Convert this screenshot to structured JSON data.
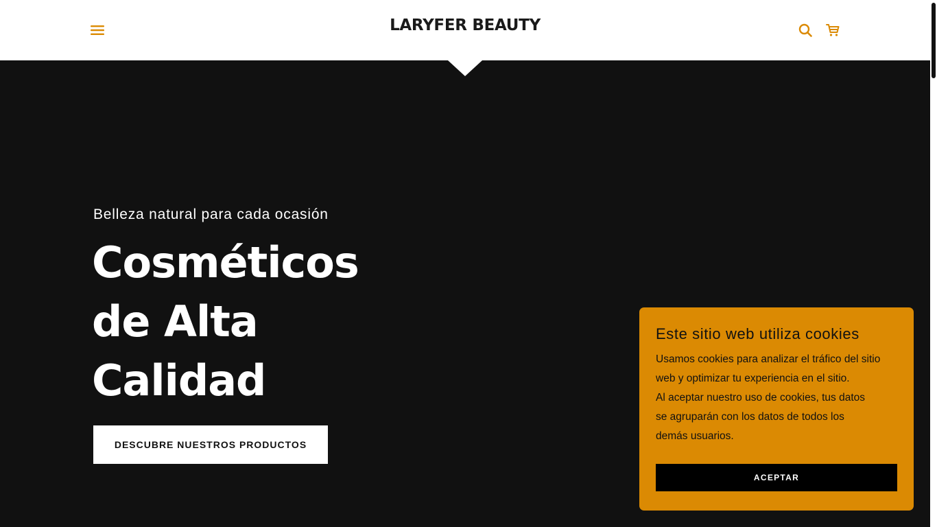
{
  "colors": {
    "accent": "#db8a03",
    "header_bg": "#ffffff",
    "hero_bg": "#111111",
    "cookie_bg": "#db8a03",
    "button_dark": "#000000"
  },
  "header": {
    "brand": "LARYFER BEAUTY",
    "menu_icon": "hamburger-menu-icon",
    "search_icon": "search-icon",
    "cart_icon": "shopping-cart-icon"
  },
  "hero": {
    "tagline": "Belleza natural para cada ocasión",
    "title": "Cosméticos\nde Alta\nCalidad",
    "cta_label": "DESCUBRE NUESTROS PRODUCTOS"
  },
  "cookie_banner": {
    "title": "Este sitio web utiliza cookies",
    "text_lines": [
      "Usamos cookies para analizar el tráfico del sitio web y optimizar tu experiencia en el sitio.",
      "Al aceptar nuestro uso de cookies, tus datos se agruparán con los datos de todos los demás usuarios."
    ],
    "accept_label": "ACEPTAR"
  }
}
